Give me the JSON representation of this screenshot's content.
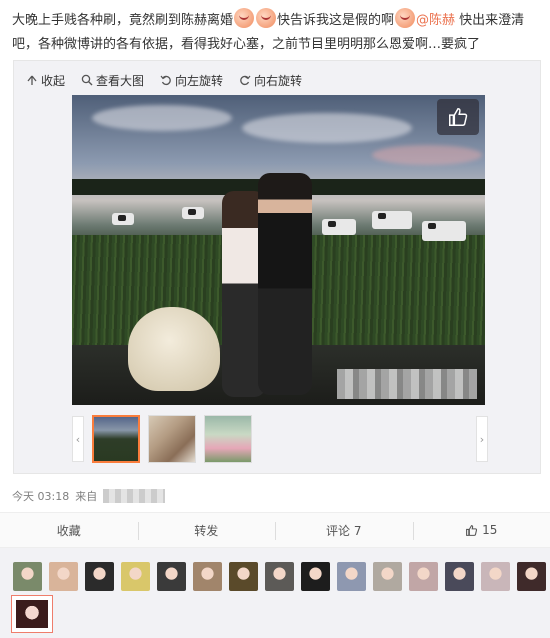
{
  "post": {
    "text_part1": "大晚上手贱各种刷，竟然刷到陈赫离婚",
    "text_part2": "快告诉我这是假的啊",
    "mention": "@陈赫",
    "text_part3": " 快出来澄清吧，各种微博讲的各有依据，看得我好心塞，之前节目里明明那么恩爱啊…要疯了"
  },
  "toolbar": {
    "collapse": "收起",
    "view_large": "查看大图",
    "rotate_left": "向左旋转",
    "rotate_right": "向右旋转"
  },
  "meta": {
    "time": "今天 03:18",
    "from": "来自"
  },
  "actions": {
    "favorite": "收藏",
    "repost": "转发",
    "comment": "评论 7",
    "like_count": "15"
  },
  "colors": {
    "accent": "#eb7350",
    "active_thumb": "#fa7d3c"
  },
  "icons": [
    "collapse-icon",
    "magnifier-icon",
    "rotate-left-icon",
    "rotate-right-icon",
    "thumbs-up-icon"
  ],
  "likers": {
    "avatar_colors": [
      "#7a8a6a",
      "#d9b49a",
      "#2b2b2b",
      "#d9c76a",
      "#3a3a3a",
      "#a1856b",
      "#5a4a2a",
      "#5c5a57",
      "#1d1d1d",
      "#8e98b0",
      "#b0a9a0",
      "#c1a6a6",
      "#4a4a5a",
      "#c9b6b9",
      "#3f2a2a"
    ]
  }
}
